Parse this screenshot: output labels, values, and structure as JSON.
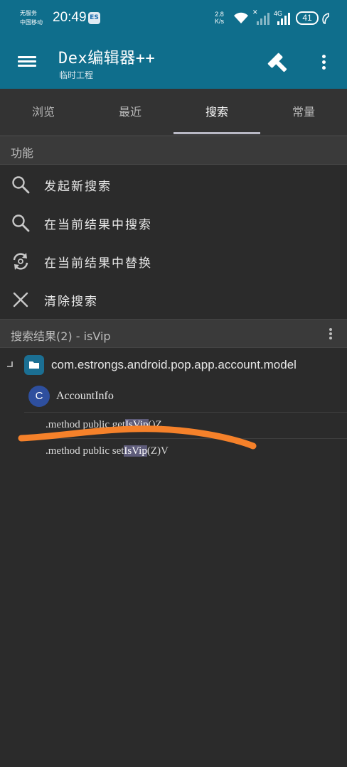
{
  "status_bar": {
    "carrier_line1": "无服务",
    "carrier_line2": "中国移动",
    "time": "20:49",
    "app_icon": "app-notification-icon",
    "speed_value": "2.8",
    "speed_unit": "K/s",
    "network_type": "4G",
    "battery_level": "41"
  },
  "app_bar": {
    "title": "Dex编辑器++",
    "subtitle": "临时工程"
  },
  "tabs": [
    {
      "label": "浏览",
      "active": false
    },
    {
      "label": "最近",
      "active": false
    },
    {
      "label": "搜索",
      "active": true
    },
    {
      "label": "常量",
      "active": false
    }
  ],
  "functions": {
    "header": "功能",
    "items": [
      {
        "label": "发起新搜索",
        "icon": "search-icon"
      },
      {
        "label": "在当前结果中搜索",
        "icon": "search-icon"
      },
      {
        "label": "在当前结果中替换",
        "icon": "replace-icon"
      },
      {
        "label": "清除搜索",
        "icon": "close-icon"
      }
    ]
  },
  "results": {
    "header": "搜索结果(2) - isVip",
    "package": "com.estrongs.android.pop.app.account.model",
    "class_badge": "C",
    "class_name": "AccountInfo",
    "methods": [
      {
        "prefix": ".method public get",
        "match": "IsVip",
        "suffix": "()Z"
      },
      {
        "prefix": ".method public set",
        "match": "IsVip",
        "suffix": "(Z)V"
      }
    ]
  },
  "colors": {
    "primary": "#0f6e8c",
    "background": "#2b2b2b",
    "highlight": "#5e5c7a",
    "annotation": "#f5812a",
    "class_badge": "#2e4f9e"
  }
}
